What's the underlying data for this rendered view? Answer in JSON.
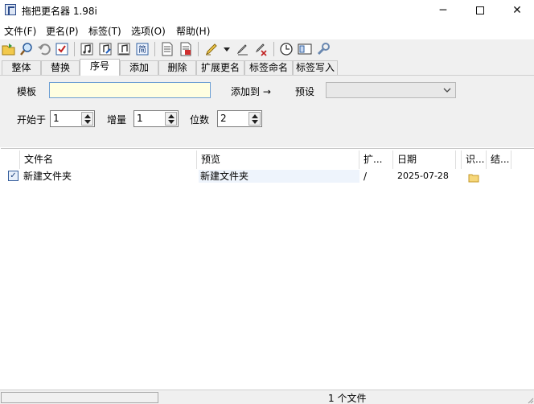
{
  "window": {
    "title": "拖把更名器 1.98i",
    "min_glyph": "─",
    "close_glyph": "✕"
  },
  "menu": [
    "文件(F)",
    "更名(P)",
    "标签(T)",
    "选项(O)",
    "帮助(H)"
  ],
  "toolbar": {
    "icons": [
      "open-folder-icon",
      "search-icon",
      "undo-icon",
      "check-icon",
      "music-tag-icon",
      "music-tag-edit-icon",
      "music-tag-list-icon",
      "simplified-icon",
      "document-icon",
      "document-edit-icon",
      "highlighter-icon",
      "dropdown-icon",
      "pen-icon",
      "pen-delete-icon",
      "clock-icon",
      "preview-window-icon",
      "wrench-icon"
    ]
  },
  "tabs": [
    {
      "label": "整体",
      "active": false
    },
    {
      "label": "替换",
      "active": false
    },
    {
      "label": "序号",
      "active": true
    },
    {
      "label": "添加",
      "active": false
    },
    {
      "label": "删除",
      "active": false
    },
    {
      "label": "扩展更名",
      "active": false
    },
    {
      "label": "标签命名",
      "active": false
    },
    {
      "label": "标签写入",
      "active": false
    }
  ],
  "panel": {
    "template_label": "模板",
    "template_value": "",
    "add_to_label": "添加到 →",
    "preset_label": "预设",
    "preset_value": "",
    "start_label": "开始于",
    "start_value": "1",
    "step_label": "增量",
    "step_value": "1",
    "digits_label": "位数",
    "digits_value": "2"
  },
  "list": {
    "columns": [
      "文件名",
      "预览",
      "扩...",
      "日期",
      "识...",
      "结..."
    ],
    "rows": [
      {
        "name": "新建文件夹",
        "preview": "新建文件夹",
        "ext": "/",
        "date": "2025-07-28",
        "checked": true
      }
    ]
  },
  "status": {
    "count_text": "1 个文件"
  }
}
